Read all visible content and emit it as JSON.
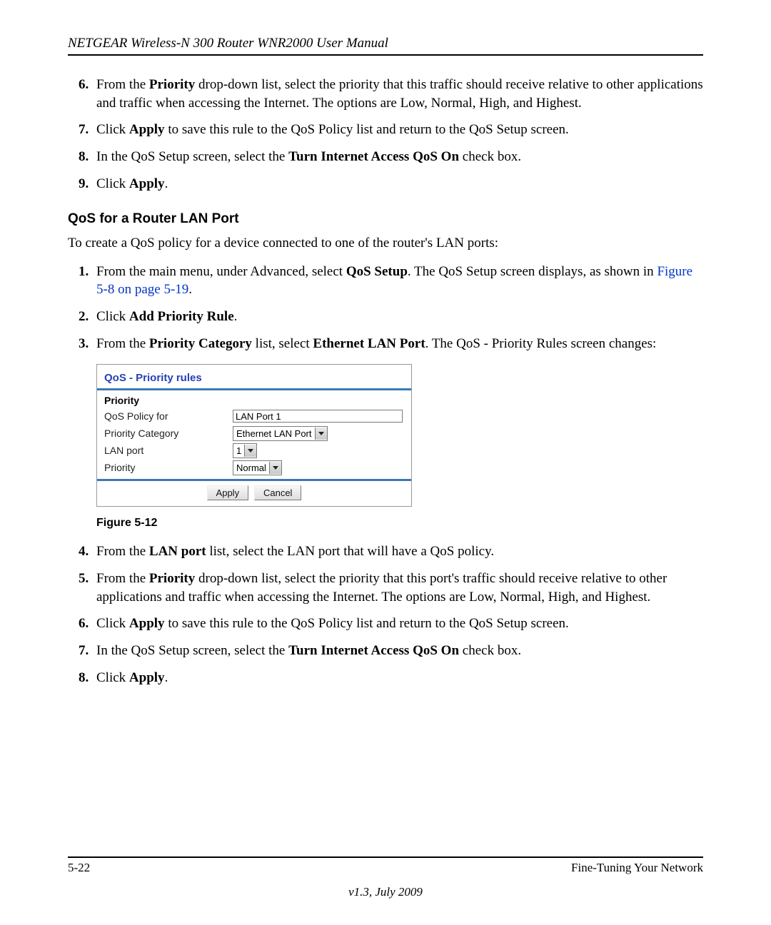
{
  "header": {
    "title": "NETGEAR Wireless-N 300 Router WNR2000 User Manual"
  },
  "upper_list_start": 6,
  "upper_list": [
    {
      "pre": "From the ",
      "b1": "Priority",
      "post": " drop-down list, select the priority that this traffic should receive relative to other applications and traffic when accessing the Internet. The options are Low, Normal, High, and Highest."
    },
    {
      "pre": "Click ",
      "b1": "Apply",
      "post": " to save this rule to the QoS Policy list and return to the QoS Setup screen."
    },
    {
      "pre": "In the QoS Setup screen, select the ",
      "b1": "Turn Internet Access QoS On",
      "post": " check box."
    },
    {
      "pre": "Click ",
      "b1": "Apply",
      "post": "."
    }
  ],
  "section_heading": "QoS for a Router LAN Port",
  "intro_para": "To create a QoS policy for a device connected to one of the router's LAN ports:",
  "mid_list": [
    {
      "pre": "From the main menu, under Advanced, select ",
      "b1": "QoS Setup",
      "post1": ". The QoS Setup screen displays, as shown in ",
      "xref": "Figure 5-8 on page 5-19",
      "post2": "."
    },
    {
      "pre": "Click ",
      "b1": "Add Priority Rule",
      "post": "."
    },
    {
      "pre": "From the ",
      "b1": "Priority Category",
      "post": " list, select ",
      "b2": "Ethernet LAN Port",
      "post2": ". The QoS - Priority Rules screen changes:"
    }
  ],
  "qos_panel": {
    "title": "QoS - Priority rules",
    "section": "Priority",
    "rows": {
      "policy_for": {
        "label": "QoS Policy for",
        "value": "LAN Port 1"
      },
      "category": {
        "label": "Priority Category",
        "value": "Ethernet LAN Port"
      },
      "lan_port": {
        "label": "LAN port",
        "value": "1"
      },
      "priority": {
        "label": "Priority",
        "value": "Normal"
      }
    },
    "buttons": {
      "apply": "Apply",
      "cancel": "Cancel"
    }
  },
  "figure_caption": "Figure 5-12",
  "lower_list_start": 4,
  "lower_list": [
    {
      "pre": "From the ",
      "b1": "LAN port",
      "post": " list, select the LAN port that will have a QoS policy."
    },
    {
      "pre": "From the ",
      "b1": "Priority",
      "post": " drop-down list, select the priority that this port's traffic should receive relative to other applications and traffic when accessing the Internet. The options are Low, Normal, High, and Highest."
    },
    {
      "pre": "Click ",
      "b1": "Apply",
      "post": " to save this rule to the QoS Policy list and return to the QoS Setup screen."
    },
    {
      "pre": "In the QoS Setup screen, select the ",
      "b1": "Turn Internet Access QoS On",
      "post": " check box."
    },
    {
      "pre": "Click ",
      "b1": "Apply",
      "post": "."
    }
  ],
  "footer": {
    "page": "5-22",
    "chapter": "Fine-Tuning Your Network",
    "version": "v1.3, July 2009"
  }
}
